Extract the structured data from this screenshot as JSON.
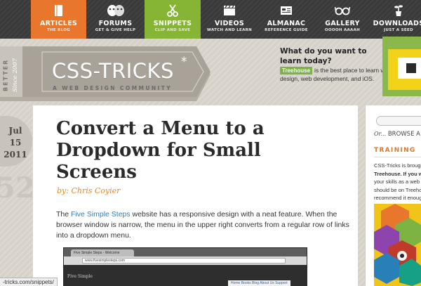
{
  "nav": {
    "items": [
      {
        "label": "ARTICLES",
        "sub": "THE BLOG",
        "icon": "book-icon"
      },
      {
        "label": "FORUMS",
        "sub": "GET & GIVE HELP",
        "icon": "masks-icon"
      },
      {
        "label": "SNIPPETS",
        "sub": "CLIP AND SAVE",
        "icon": "scissors-icon"
      },
      {
        "label": "VIDEOS",
        "sub": "WATCH AND LEARN",
        "icon": "clapperboard-icon"
      },
      {
        "label": "ALMANAC",
        "sub": "REFERENCE GUIDE",
        "icon": "almanac-icon"
      },
      {
        "label": "GALLERY",
        "sub": "OOOOH AAAAH",
        "icon": "glasses-icon"
      },
      {
        "label": "DOWNLOADS",
        "sub": "JUST A SEED",
        "icon": "plant-icon"
      }
    ],
    "colors": {
      "articles": "#e8762d",
      "snippets": "#86b536",
      "bar": "#3a3a3a"
    }
  },
  "header": {
    "logo_main": "CSS-TRICKS",
    "logo_star": "*",
    "tagline": "A WEB DESIGN COMMUNITY",
    "side_better": "BETTER",
    "side_since": "Since 2007"
  },
  "promo": {
    "title": "What do you want to learn today?",
    "badge": "Treehouse",
    "text": "is the best place to learn web design, web development, and iOS."
  },
  "post": {
    "date_month": "Jul",
    "date_day": "15",
    "date_year": "2011",
    "date_ghost": "52",
    "title": "Convert a Menu to a Dropdown for Small Screens",
    "byline": "by: Chris Coyier",
    "body_pre": "The ",
    "body_link": "Five Simple Steps",
    "body_post": " website has a responsive design with a neat feature. When the browser window is narrow, the menu in the upper right converts from a regular row of links into a dropdown menu."
  },
  "screenshot": {
    "tab_title": "Five Simple Steps - Welcome",
    "url": "www.fivesimplesteps.com",
    "brand": "Five Simple",
    "menu": "Home   Books   Blog   About Us   Support"
  },
  "sidebar": {
    "browse_or": "Or...",
    "browse": "BROWSE A",
    "heading": "TRAINING",
    "lines": [
      "CSS-Tricks is brought",
      "Treehouse. If you wa",
      "your skills as a web w",
      "should be on Treeho",
      "recommend it enoug"
    ]
  },
  "statusbar": {
    "text": "-tricks.com/snippets/"
  }
}
